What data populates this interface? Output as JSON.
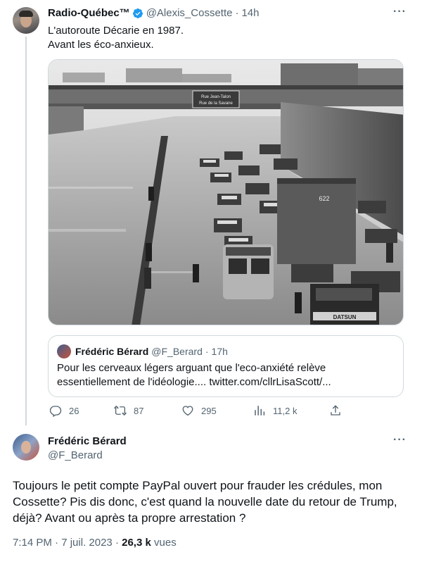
{
  "tweet1": {
    "name": "Radio-Québec™",
    "handle": "@Alexis_Cossette",
    "sep": "·",
    "time": "14h",
    "text_line1": "L'autoroute Décarie en 1987.",
    "text_line2": "Avant les éco-anxieux.",
    "photo_signs": {
      "overpass_sign": [
        "Rue Jean-Talon",
        "Rue de la Savane"
      ],
      "truck_number": "622",
      "grille_text": "DATSUN"
    },
    "quote": {
      "name": "Frédéric Bérard",
      "handle": "@F_Berard",
      "sep": "·",
      "time": "17h",
      "text": "Pour les cerveaux légers arguant que l'eco-anxiété relève essentiellement de l'idéologie.... twitter.com/cllrLisaScott/..."
    },
    "actions": {
      "replies": "26",
      "retweets": "87",
      "likes": "295",
      "views": "11,2 k"
    }
  },
  "tweet2": {
    "name": "Frédéric Bérard",
    "handle": "@F_Berard",
    "text": "Toujours le petit compte PayPal ouvert pour frauder les crédules, mon Cossette? Pis dis donc, c'est quand la nouvelle date du retour de Trump, déjà? Avant ou après ta propre arrestation ?",
    "time": "7:14 PM",
    "sep": "·",
    "date": "7 juil. 2023",
    "views_count": "26,3 k",
    "views_label": "vues"
  },
  "icons": {
    "more": "more-icon",
    "verified": "verified-badge-icon",
    "reply": "reply-icon",
    "retweet": "retweet-icon",
    "like": "heart-icon",
    "views": "views-chart-icon",
    "share": "share-icon"
  },
  "colors": {
    "text": "#0f1419",
    "secondary": "#536471",
    "border": "#cfd9de",
    "verified": "#1d9bf0"
  }
}
